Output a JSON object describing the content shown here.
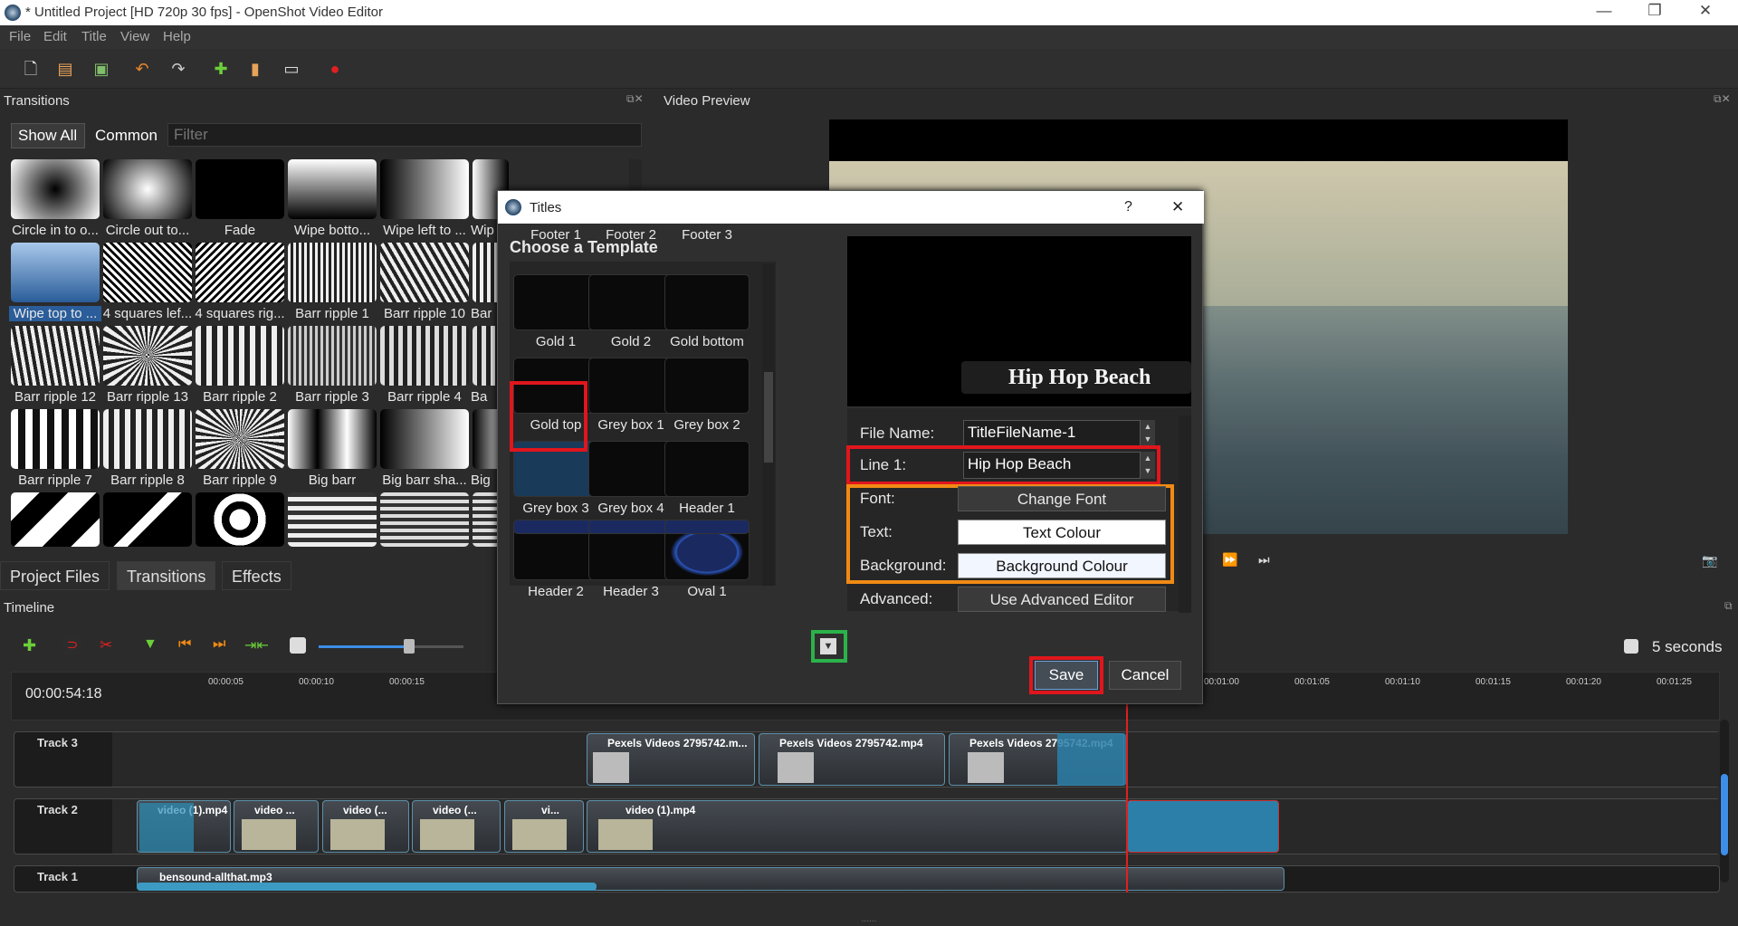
{
  "app": {
    "title": "* Untitled Project [HD 720p 30 fps] - OpenShot Video Editor"
  },
  "menu": [
    "File",
    "Edit",
    "Title",
    "View",
    "Help"
  ],
  "transitions_panel": {
    "title": "Transitions",
    "show_all": "Show All",
    "common": "Common",
    "filter_placeholder": "Filter",
    "items": [
      "Circle in to o...",
      "Circle out to...",
      "Fade",
      "Wipe botto...",
      "Wipe left to ...",
      "Wip",
      "Wipe top to ...",
      "4 squares lef...",
      "4 squares rig...",
      "Barr ripple 1",
      "Barr ripple 10",
      "Bar",
      "Barr ripple 12",
      "Barr ripple 13",
      "Barr ripple 2",
      "Barr ripple 3",
      "Barr ripple 4",
      "Ba",
      "Barr ripple 7",
      "Barr ripple 8",
      "Barr ripple 9",
      "Big barr",
      "Big barr sha...",
      "Big"
    ]
  },
  "tabs": [
    "Project Files",
    "Transitions",
    "Effects"
  ],
  "video_preview": {
    "title": "Video Preview"
  },
  "timeline": {
    "title": "Timeline",
    "timecode": "00:00:54:18",
    "zoom_label": "5 seconds",
    "ruler": [
      "00:00:05",
      "00:00:10",
      "00:00:15",
      "00:01:00",
      "00:01:05",
      "00:01:10",
      "00:01:15",
      "00:01:20",
      "00:01:25"
    ],
    "tracks": [
      "Track 3",
      "Track 2",
      "Track 1"
    ],
    "track3_clips": [
      "Pexels Videos 2795742.m...",
      "Pexels Videos 2795742.mp4",
      "Pexels Videos 2795742.mp4"
    ],
    "track2_clips": [
      "video (1).mp4",
      "video ...",
      "video (...",
      "video (...",
      "vi...",
      "video (1).mp4"
    ],
    "track1_clip": "bensound-allthat.mp3"
  },
  "dialog": {
    "title": "Titles",
    "help": "?",
    "close": "✕",
    "heading": "Choose a Template",
    "templates": [
      "Footer 1",
      "Footer 2",
      "Footer 3",
      "Gold 1",
      "Gold 2",
      "Gold bottom",
      "Gold top",
      "Grey box 1",
      "Grey box 2",
      "Grey box 3",
      "Grey box 4",
      "Header 1",
      "Header 2",
      "Header 3",
      "Oval 1"
    ],
    "preview_text": "Hip Hop Beach",
    "file_name_label": "File Name:",
    "file_name_value": "TitleFileName-1",
    "line1_label": "Line 1:",
    "line1_value": "Hip Hop Beach",
    "font_label": "Font:",
    "font_button": "Change Font",
    "text_label": "Text:",
    "text_button": "Text Colour",
    "bg_label": "Background:",
    "bg_button": "Background Colour",
    "advanced_label": "Advanced:",
    "advanced_button": "Use Advanced Editor",
    "save": "Save",
    "cancel": "Cancel"
  }
}
